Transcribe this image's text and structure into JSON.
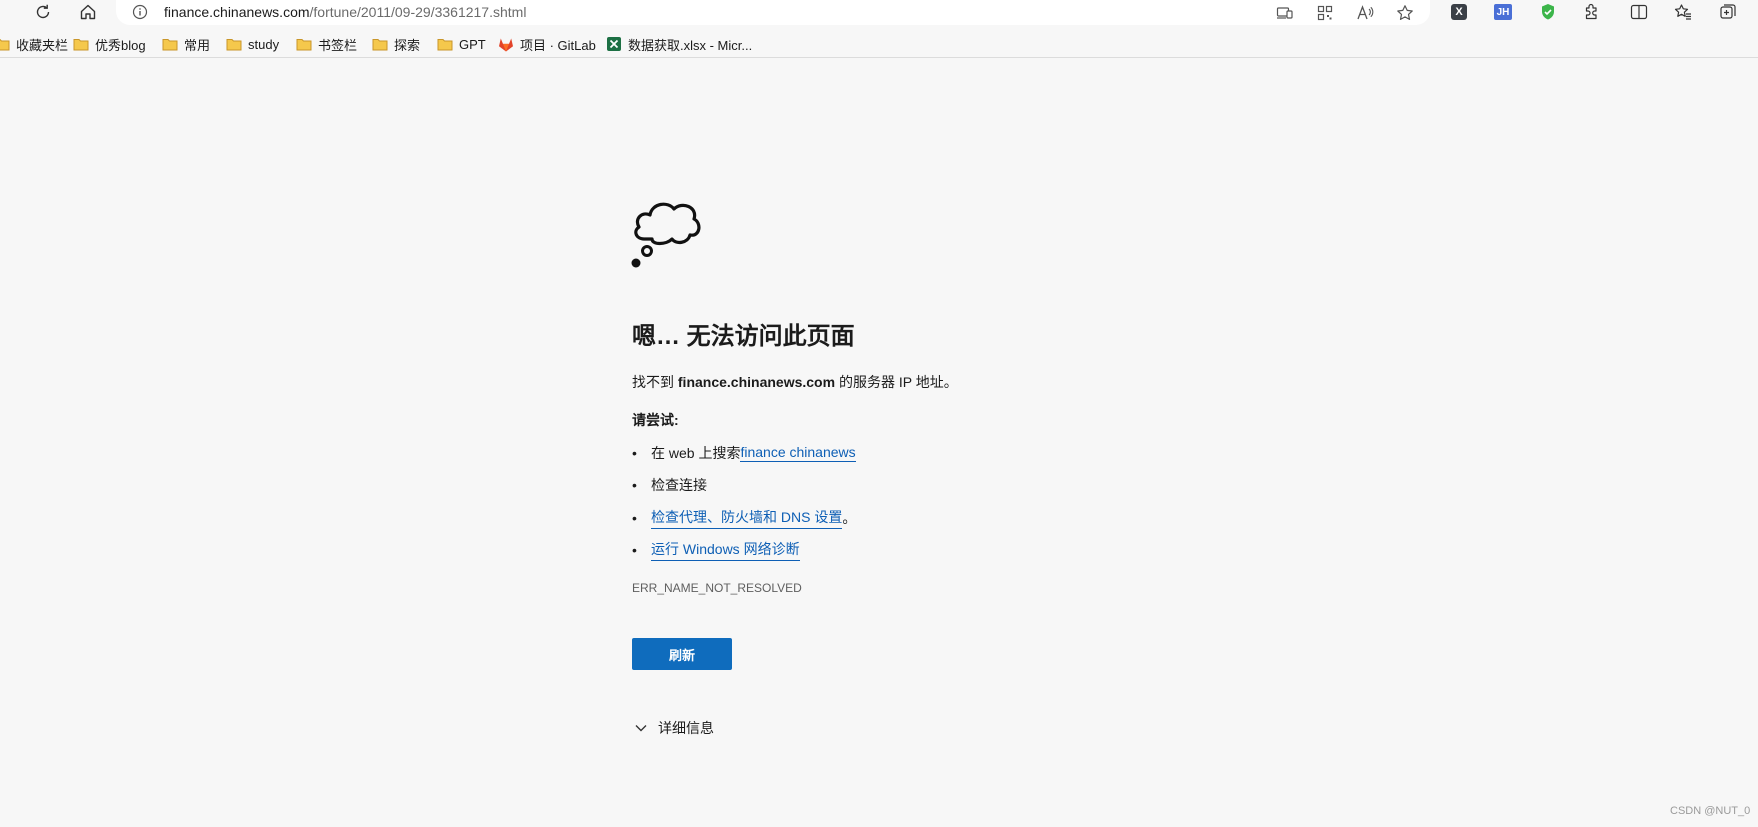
{
  "toolbar": {
    "refresh_icon": "refresh-icon",
    "home_icon": "home-icon",
    "address": {
      "host": "finance.chinanews.com",
      "path": "/fortune/2011/09-29/3361217.shtml"
    }
  },
  "extensions": {
    "ext_x_label": "X",
    "ext_jh_label": "JH"
  },
  "bookmarks": [
    {
      "label": "收藏夹栏",
      "icon": "folder-icon"
    },
    {
      "label": "优秀blog",
      "icon": "folder-icon"
    },
    {
      "label": "常用",
      "icon": "folder-icon"
    },
    {
      "label": "study",
      "icon": "folder-icon"
    },
    {
      "label": "书签栏",
      "icon": "folder-icon"
    },
    {
      "label": "探索",
      "icon": "folder-icon"
    },
    {
      "label": "GPT",
      "icon": "folder-icon"
    },
    {
      "label": "项目 · GitLab",
      "icon": "gitlab-icon"
    },
    {
      "label": "数据获取.xlsx - Micr...",
      "icon": "excel-icon"
    }
  ],
  "error": {
    "title": "嗯… 无法访问此页面",
    "desc_prefix": "找不到 ",
    "desc_host": "finance.chinanews.com",
    "desc_suffix": " 的服务器 IP 地址。",
    "try_heading": "请尝试:",
    "suggestions": {
      "s1_prefix": "在 web 上搜索 ",
      "s1_link": "finance chinanews",
      "s2": "检查连接",
      "s3_link": "检查代理、防火墙和 DNS 设置",
      "s3_suffix": "。",
      "s4_link": "运行 Windows 网络诊断"
    },
    "code": "ERR_NAME_NOT_RESOLVED",
    "refresh_label": "刷新",
    "details_label": "详细信息"
  },
  "watermark": "CSDN @NUT_0",
  "colors": {
    "accent": "#0f6cbd",
    "link": "#0e5fb5",
    "background": "#f7f7f7"
  }
}
